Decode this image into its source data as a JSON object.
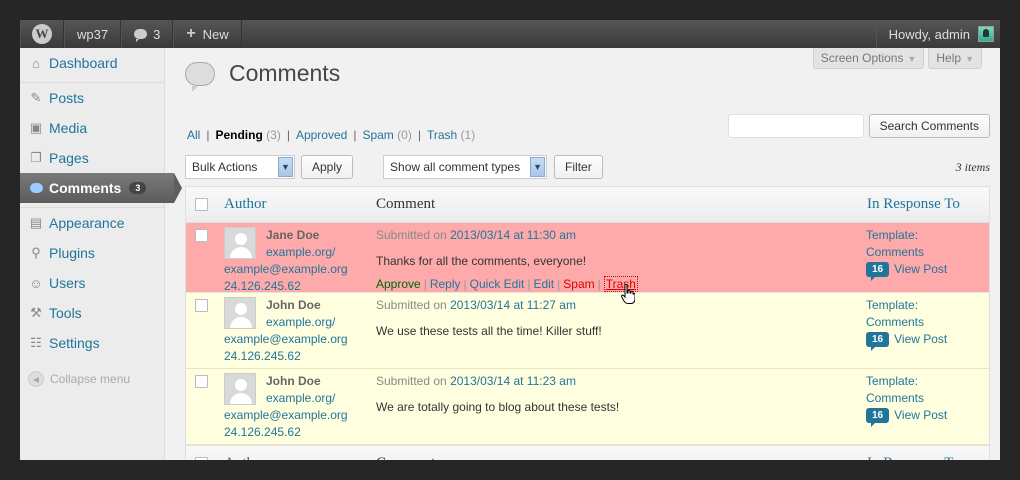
{
  "adminbar": {
    "site_name": "wp37",
    "comments_count": "3",
    "new_label": "New",
    "howdy": "Howdy, admin"
  },
  "sidebar": {
    "items": [
      {
        "label": "Dashboard",
        "icon": "dashboard-icon"
      },
      {
        "label": "Posts",
        "icon": "pin-icon"
      },
      {
        "label": "Media",
        "icon": "media-icon"
      },
      {
        "label": "Pages",
        "icon": "pages-icon"
      },
      {
        "label": "Comments",
        "icon": "comment-bubble-icon",
        "badge": "3"
      },
      {
        "label": "Appearance",
        "icon": "appearance-icon"
      },
      {
        "label": "Plugins",
        "icon": "plugin-icon"
      },
      {
        "label": "Users",
        "icon": "users-icon"
      },
      {
        "label": "Tools",
        "icon": "tools-icon"
      },
      {
        "label": "Settings",
        "icon": "settings-icon"
      }
    ],
    "collapse_label": "Collapse menu"
  },
  "header": {
    "title": "Comments",
    "screen_options": "Screen Options",
    "help": "Help"
  },
  "filters": {
    "all": "All",
    "pending": "Pending",
    "pending_count": "(3)",
    "approved": "Approved",
    "spam": "Spam",
    "spam_count": "(0)",
    "trash": "Trash",
    "trash_count": "(1)"
  },
  "search": {
    "value": "",
    "button": "Search Comments"
  },
  "tablenav": {
    "bulk_actions": "Bulk Actions",
    "apply": "Apply",
    "comment_types": "Show all comment types",
    "filter": "Filter",
    "items": "3 items"
  },
  "table": {
    "headers": {
      "author": "Author",
      "comment": "Comment",
      "response": "In Response To"
    },
    "rows": [
      {
        "name": "Jane Doe",
        "url": "example.org/",
        "email": "example@example.org",
        "ip": "24.126.245.62",
        "submitted_prefix": "Submitted on",
        "date": "2013/03/14 at 11:30 am",
        "text": "Thanks for all the comments, everyone!",
        "resp_line1": "Template:",
        "resp_line2": "Comments",
        "resp_count": "16",
        "view_post": "View Post"
      },
      {
        "name": "John Doe",
        "url": "example.org/",
        "email": "example@example.org",
        "ip": "24.126.245.62",
        "submitted_prefix": "Submitted on",
        "date": "2013/03/14 at 11:27 am",
        "text": "We use these tests all the time! Killer stuff!",
        "resp_line1": "Template:",
        "resp_line2": "Comments",
        "resp_count": "16",
        "view_post": "View Post"
      },
      {
        "name": "John Doe",
        "url": "example.org/",
        "email": "example@example.org",
        "ip": "24.126.245.62",
        "submitted_prefix": "Submitted on",
        "date": "2013/03/14 at 11:23 am",
        "text": "We are totally going to blog about these tests!",
        "resp_line1": "Template:",
        "resp_line2": "Comments",
        "resp_count": "16",
        "view_post": "View Post"
      }
    ],
    "row_actions": {
      "approve": "Approve",
      "reply": "Reply",
      "quick_edit": "Quick Edit",
      "edit": "Edit",
      "spam": "Spam",
      "trash": "Trash"
    }
  },
  "colors": {
    "link": "#21759b",
    "highlight_row": "#ffaaaa",
    "unapproved_row": "#ffffe0",
    "adminbar": "#464646"
  }
}
